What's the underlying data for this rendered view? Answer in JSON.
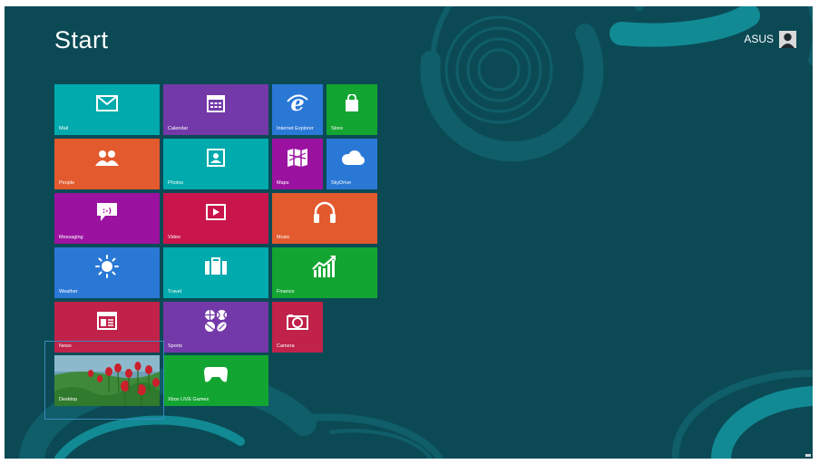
{
  "start": {
    "title": "Start"
  },
  "user": {
    "name": "ASUS"
  },
  "colors": {
    "background": "#0b4a55",
    "teal": "#00aaad",
    "purple": "#7339a8",
    "blue": "#2a78d6",
    "green": "#13a531",
    "orange": "#e25a2d",
    "magenta": "#9b12a0",
    "red": "#c8154c",
    "crimson": "#c0224a"
  },
  "tiles": {
    "mail": {
      "label": "Mail",
      "icon": "mail-envelope-icon"
    },
    "calendar": {
      "label": "Calendar",
      "icon": "calendar-icon"
    },
    "ie": {
      "label": "Internet Explorer",
      "icon": "internet-explorer-icon"
    },
    "store": {
      "label": "Store",
      "icon": "store-bag-icon"
    },
    "people": {
      "label": "People",
      "icon": "people-icon"
    },
    "photos": {
      "label": "Photos",
      "icon": "photos-icon"
    },
    "maps": {
      "label": "Maps",
      "icon": "maps-icon"
    },
    "skydrive": {
      "label": "SkyDrive",
      "icon": "skydrive-cloud-icon"
    },
    "messaging": {
      "label": "Messaging",
      "icon": "messaging-icon"
    },
    "video": {
      "label": "Video",
      "icon": "video-play-icon"
    },
    "music": {
      "label": "Music",
      "icon": "headphones-icon"
    },
    "weather": {
      "label": "Weather",
      "icon": "sun-icon"
    },
    "travel": {
      "label": "Travel",
      "icon": "suitcase-icon"
    },
    "finance": {
      "label": "Finance",
      "icon": "finance-chart-icon"
    },
    "news": {
      "label": "News",
      "icon": "newspaper-icon"
    },
    "sports": {
      "label": "Sports",
      "icon": "sports-balls-icon"
    },
    "camera": {
      "label": "Camera",
      "icon": "camera-icon"
    },
    "desktop": {
      "label": "Desktop",
      "icon": "desktop-wallpaper-thumbnail"
    },
    "xbox": {
      "label": "Xbox LIVE Games",
      "icon": "xbox-controller-icon"
    }
  }
}
